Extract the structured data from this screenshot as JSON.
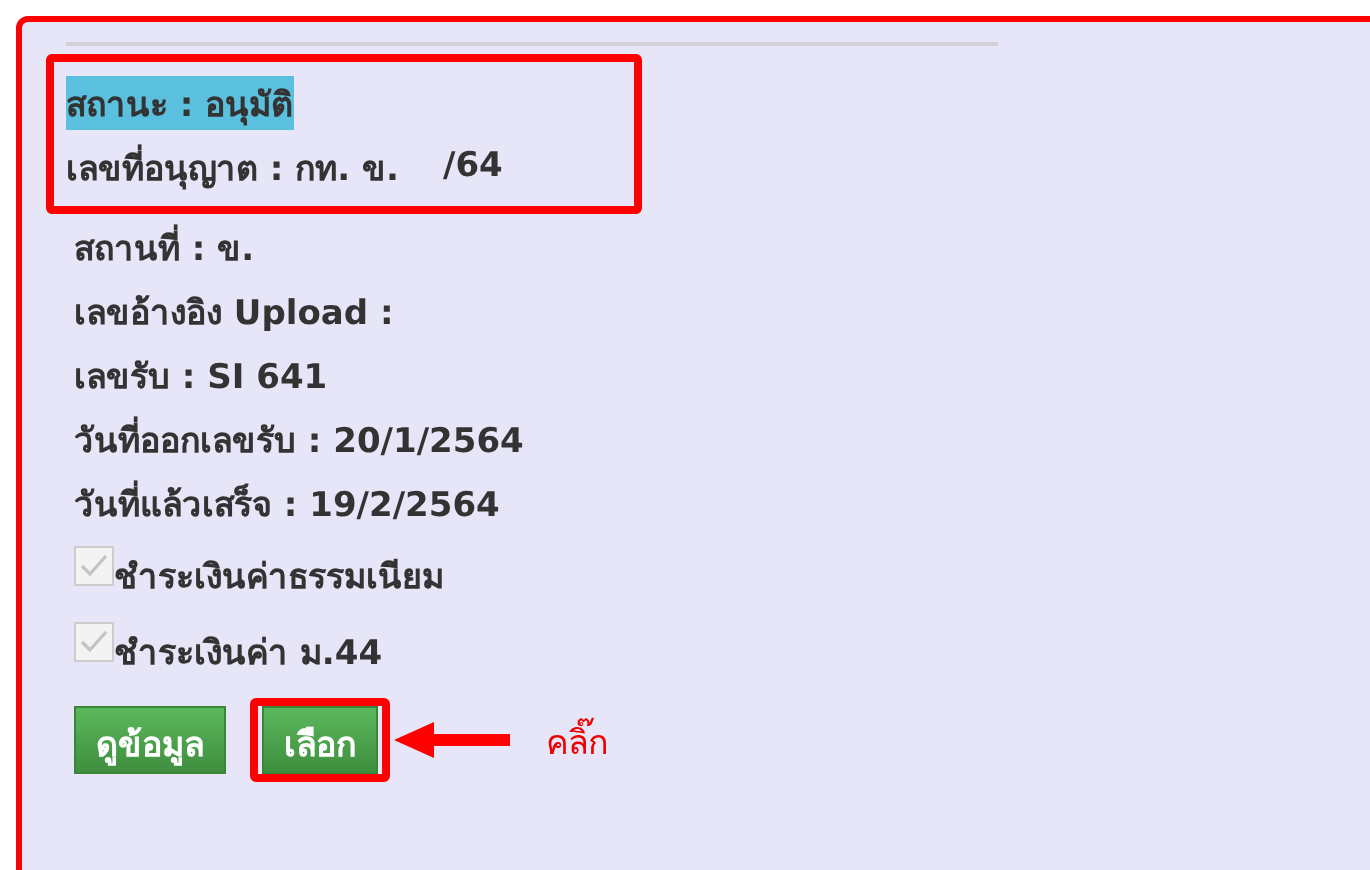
{
  "framed_details": [
    {
      "text": "สถานะ : อนุมัติ",
      "highlighted": true
    },
    {
      "text": "เลขที่อนุญาต : กท. ข.",
      "suffix": "/64",
      "highlighted": false
    }
  ],
  "details": [
    {
      "text": "สถานที่ : ข.",
      "highlighted": false
    },
    {
      "text": "เลขอ้างอิง Upload :",
      "highlighted": false
    },
    {
      "text": "เลขรับ : SI 641",
      "highlighted": false
    },
    {
      "text": "วันที่ออกเลขรับ : 20/1/2564",
      "highlighted": false
    },
    {
      "text": "วันที่แล้วเสร็จ : 19/2/2564",
      "highlighted": false
    }
  ],
  "checks": [
    {
      "label": "ชำระเงินค่าธรรมเนียม",
      "checked": true,
      "disabled": true
    },
    {
      "label": "ชำระเงินค่า ม.44",
      "checked": true,
      "disabled": true
    }
  ],
  "buttons": [
    {
      "label": "ดูข้อมูล",
      "framed": false
    },
    {
      "label": "เลือก",
      "framed": true
    }
  ],
  "callout": {
    "text": "คลิ๊ก"
  }
}
